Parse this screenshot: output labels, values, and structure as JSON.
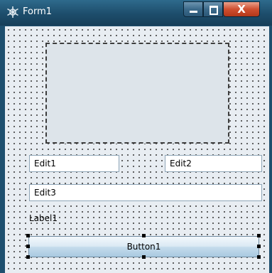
{
  "window": {
    "title": "Form1",
    "close_glyph": "X"
  },
  "form": {
    "edit1": "Edit1",
    "edit2": "Edit2",
    "edit3": "Edit3",
    "label1": "Label1",
    "button1": "Button1"
  },
  "icons": {
    "app": "delphi-form-icon",
    "minimize": "minimize-icon",
    "maximize": "maximize-icon",
    "close": "close-icon"
  },
  "colors": {
    "titlebar": "#1d4d6b",
    "client_background": "#e8edf2",
    "close_button": "#cf4f30",
    "button_face": "#c5dcec"
  }
}
